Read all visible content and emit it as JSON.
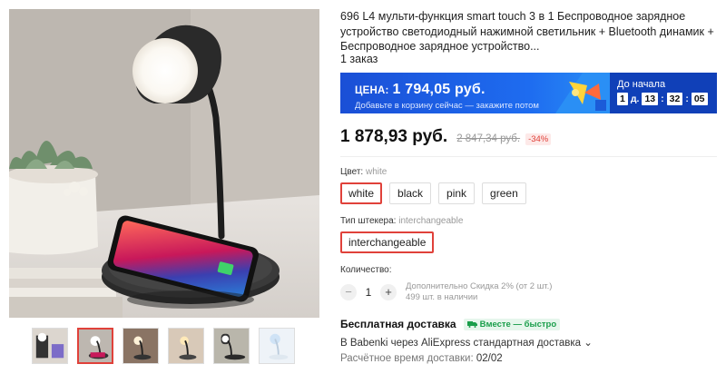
{
  "product": {
    "title": "696 L4 мульти-функция smart touch 3 в 1 Беспроводное зарядное устройство светодиодный нажимной светильник + Bluetooth динамик + Беспроводное зарядное устройство...",
    "orders": "1 заказ"
  },
  "promo": {
    "price_label": "ЦЕНА:",
    "price": "1 794,05 руб.",
    "subtext": "Добавьте в корзину сейчас — закажите потом",
    "timer_label": "До начала",
    "days": "1",
    "days_unit": "д.",
    "hours": "13",
    "minutes": "32",
    "seconds": "05",
    "colors": {
      "banner": "#1e6cf0",
      "timer": "#1040b8"
    }
  },
  "price": {
    "current": "1 878,93 руб.",
    "old": "2 847,34 руб.",
    "discount": "-34%"
  },
  "options": {
    "color": {
      "label": "Цвет:",
      "selected": "white",
      "values": [
        "white",
        "black",
        "pink",
        "green"
      ]
    },
    "plug": {
      "label": "Тип штекера:",
      "selected": "interchangeable",
      "values": [
        "interchangeable"
      ]
    }
  },
  "quantity": {
    "label": "Количество:",
    "value": "1",
    "minus": "−",
    "plus": "+",
    "note_line1": "Дополнительно Скидка 2% (от 2 шт.)",
    "note_line2": "499 шт. в наличии"
  },
  "shipping": {
    "title": "Бесплатная доставка",
    "badge": "Вместе — быстро",
    "method": "В Babenki через AliExpress стандартная доставка",
    "time_label": "Расчётное время доставки:",
    "time_value": "02/02"
  },
  "accent_color": "#e0413a"
}
